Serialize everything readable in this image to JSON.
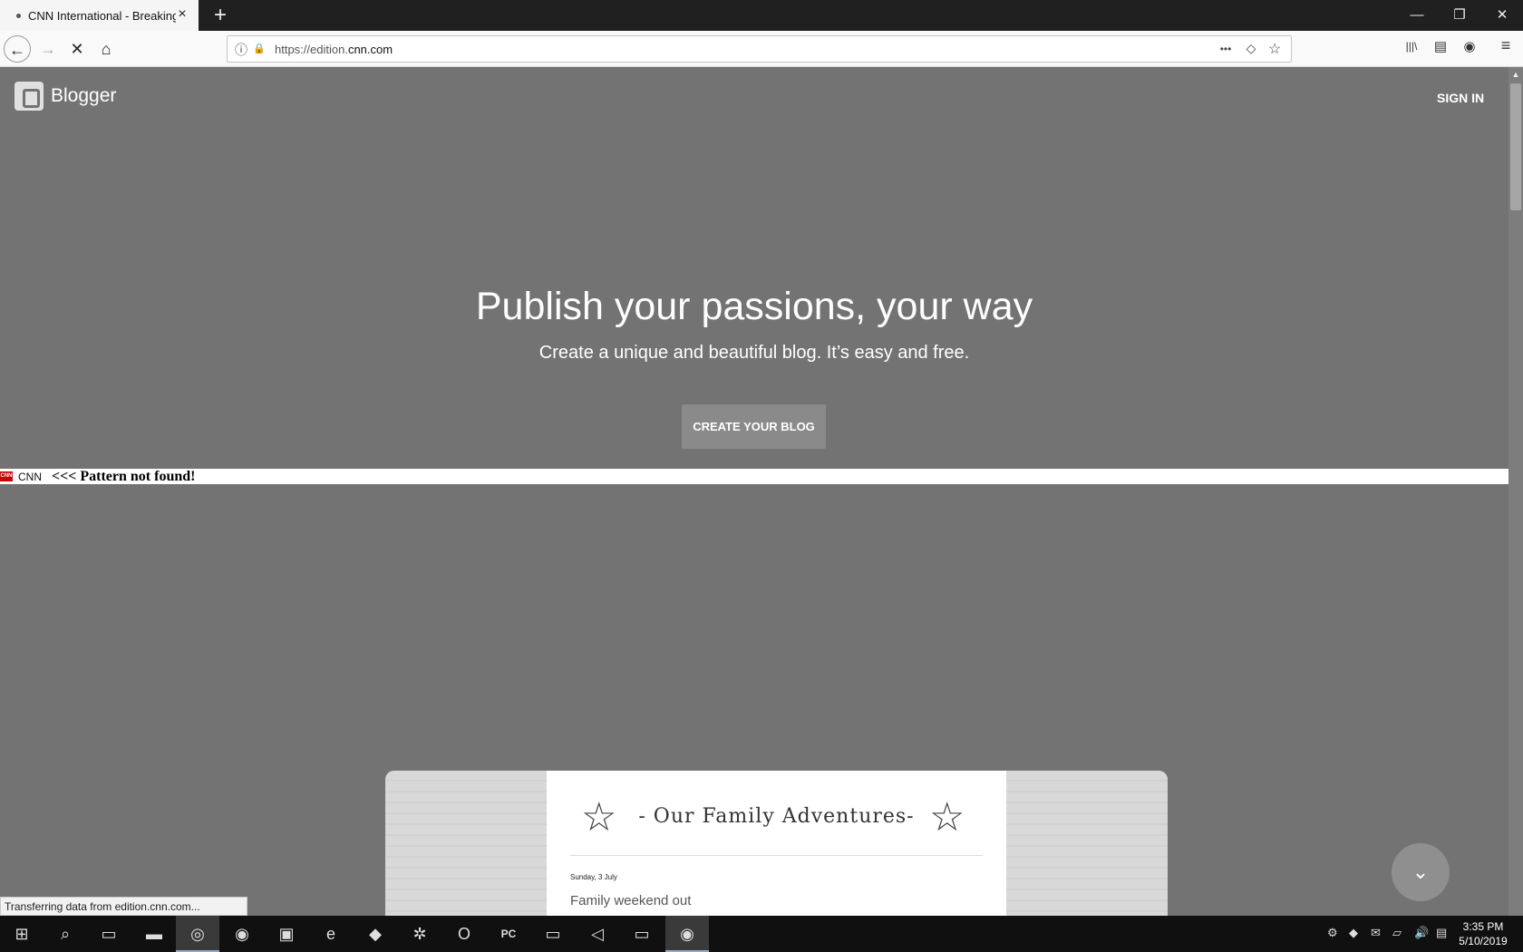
{
  "browser": {
    "tab_title": "CNN International - Breaking N",
    "tab_close": "×",
    "new_tab": "+",
    "window_minimize": "—",
    "window_restore": "❐",
    "window_close": "✕",
    "url_prefix": "https://edition.",
    "url_domain": "cnn.com",
    "status_text": "Transferring data from edition.cnn.com..."
  },
  "page": {
    "brand": "Blogger",
    "sign_in": "SIGN IN",
    "hero_title": "Publish your passions, your way",
    "hero_subtitle": "Create a unique and beautiful blog. It’s easy and free.",
    "create_button": "CREATE YOUR BLOG",
    "cnn_logo": "CNN",
    "cnn_label": "CNN",
    "cnn_message": "<<< Pattern not found!",
    "preview": {
      "title": "- Our Family Adventures-",
      "date": "Sunday, 3 July",
      "post_title": "Family weekend out"
    }
  },
  "taskbar": {
    "time": "3:35 PM",
    "date": "5/10/2019"
  },
  "icons": {
    "back": "←",
    "forward": "→",
    "stop": "✕",
    "home": "⌂",
    "info": "ⓘ",
    "lock": "🔒",
    "more": "•••",
    "pocket": "◇",
    "star": "☆",
    "library": "|||\\",
    "sidebar": "▤",
    "account": "◉",
    "menu": "≡",
    "scroll_up": "▲",
    "chevron_down": "⌄",
    "preview_star": "☆"
  }
}
